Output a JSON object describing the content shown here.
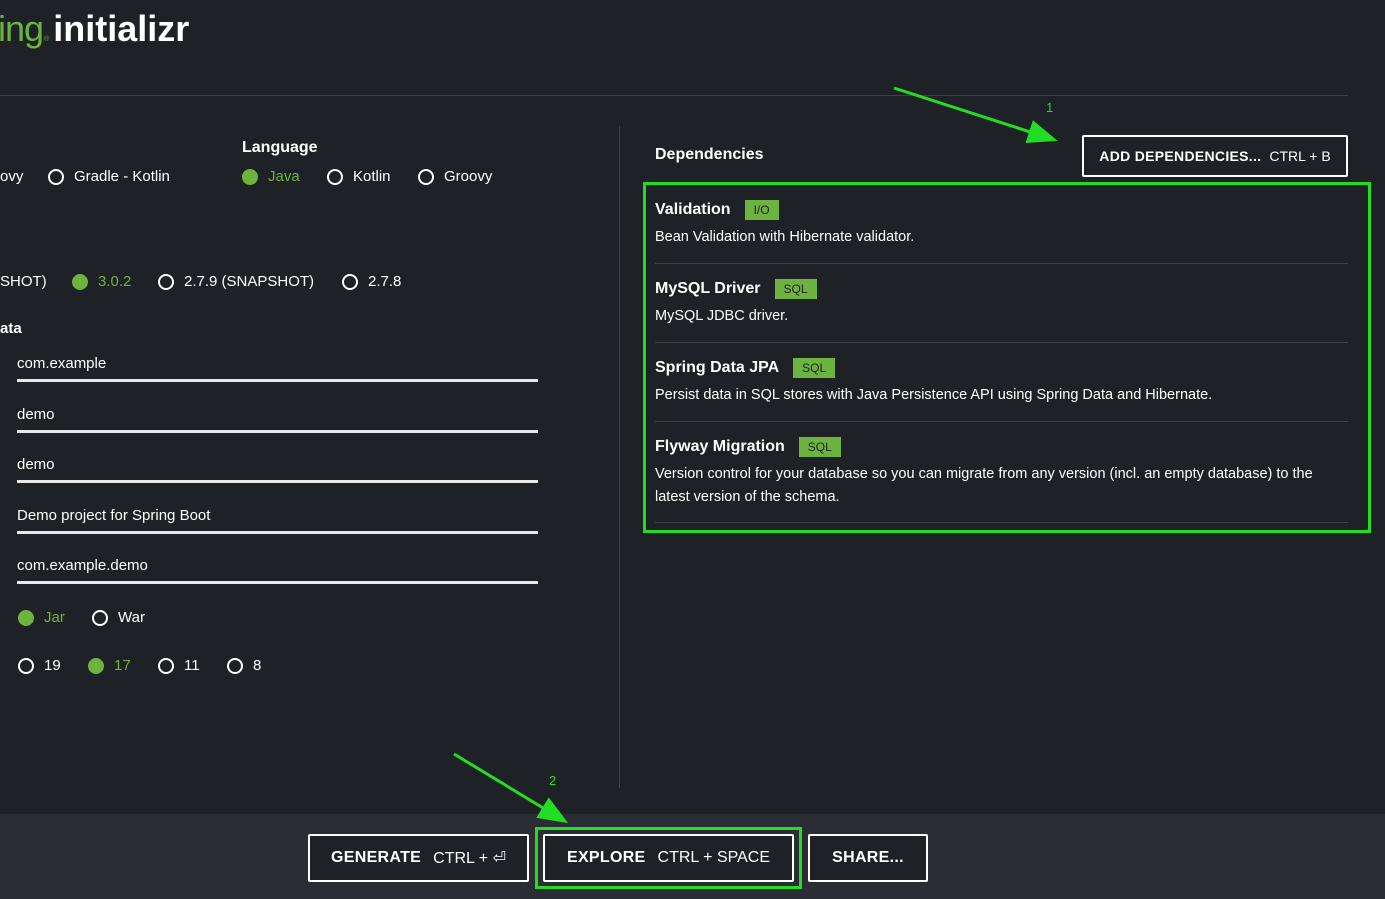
{
  "logo": {
    "brand_fragment": "ing",
    "registered": "®",
    "product": "initializr"
  },
  "project": {
    "partial_option": "ovy",
    "options": [
      {
        "label": "Gradle - Kotlin",
        "selected": false
      }
    ]
  },
  "language": {
    "title": "Language",
    "options": [
      {
        "label": "Java",
        "selected": true
      },
      {
        "label": "Kotlin",
        "selected": false
      },
      {
        "label": "Groovy",
        "selected": false
      }
    ]
  },
  "spring_boot": {
    "partial_option": "SHOT)",
    "options": [
      {
        "label": "3.0.2",
        "selected": true
      },
      {
        "label": "2.7.9 (SNAPSHOT)",
        "selected": false
      },
      {
        "label": "2.7.8",
        "selected": false
      }
    ]
  },
  "metadata": {
    "title_fragment": "ata",
    "fields": [
      {
        "value": "com.example"
      },
      {
        "value": "demo"
      },
      {
        "value": "demo"
      },
      {
        "value": "Demo project for Spring Boot"
      },
      {
        "value": "com.example.demo"
      }
    ]
  },
  "packaging": {
    "options": [
      {
        "label": "Jar",
        "selected": true
      },
      {
        "label": "War",
        "selected": false
      }
    ]
  },
  "java": {
    "options": [
      {
        "label": "19",
        "selected": false
      },
      {
        "label": "17",
        "selected": true
      },
      {
        "label": "11",
        "selected": false
      },
      {
        "label": "8",
        "selected": false
      }
    ]
  },
  "dependencies": {
    "title": "Dependencies",
    "add_button": {
      "label": "ADD DEPENDENCIES...",
      "shortcut": "CTRL + B"
    },
    "items": [
      {
        "name": "Validation",
        "tag": "I/O",
        "description": "Bean Validation with Hibernate validator."
      },
      {
        "name": "MySQL Driver",
        "tag": "SQL",
        "description": "MySQL JDBC driver."
      },
      {
        "name": "Spring Data JPA",
        "tag": "SQL",
        "description": "Persist data in SQL stores with Java Persistence API using Spring Data and Hibernate."
      },
      {
        "name": "Flyway Migration",
        "tag": "SQL",
        "description": "Version control for your database so you can migrate from any version (incl. an empty database) to the latest version of the schema."
      }
    ]
  },
  "footer": {
    "generate": {
      "label": "GENERATE",
      "shortcut": "CTRL + ⏎"
    },
    "explore": {
      "label": "EXPLORE",
      "shortcut": "CTRL + SPACE"
    },
    "share": {
      "label": "SHARE..."
    }
  },
  "annotations": {
    "marker_1": "1",
    "marker_2": "2",
    "color": "#22dd22"
  },
  "colors": {
    "accent": "#6db33f",
    "background": "#1e2126",
    "footer": "#2a2d33"
  }
}
